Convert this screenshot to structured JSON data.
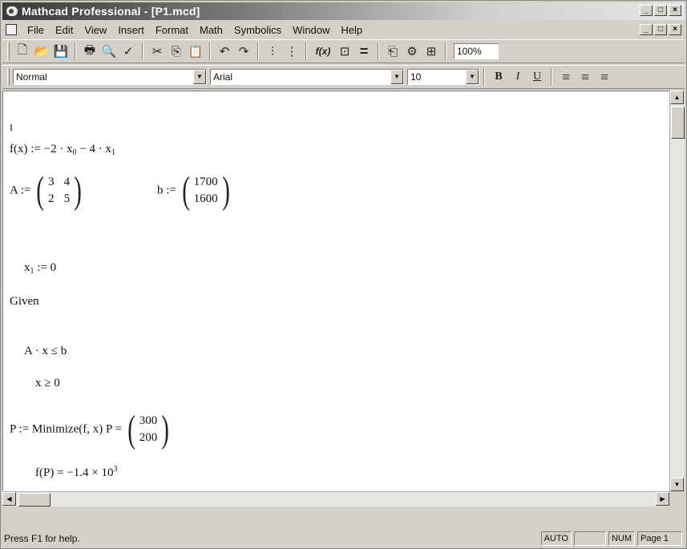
{
  "window": {
    "title": "Mathcad Professional - [P1.mcd]",
    "buttons": {
      "minimize": "_",
      "maximize": "□",
      "close": "×"
    }
  },
  "menubar": {
    "items": [
      {
        "label": "File"
      },
      {
        "label": "Edit"
      },
      {
        "label": "View"
      },
      {
        "label": "Insert"
      },
      {
        "label": "Format"
      },
      {
        "label": "Math"
      },
      {
        "label": "Symbolics"
      },
      {
        "label": "Window"
      },
      {
        "label": "Help"
      }
    ]
  },
  "toolbar": {
    "zoom": "100%",
    "icons": {
      "new": "🗋",
      "open": "📂",
      "save": "💾",
      "print": "🖶",
      "preview": "🔍",
      "spell": "✓",
      "cut": "✂",
      "copy": "⎘",
      "paste": "📋",
      "undo": "↶",
      "redo": "↷",
      "insert_graph": "⫶",
      "insert_matrix": "⋮",
      "insert_function": "f(x)",
      "insert_units": "⊡",
      "calculate": "=",
      "resource": "⎗",
      "components": "⚙",
      "align": "⊞"
    }
  },
  "formatbar": {
    "style": "Normal",
    "font": "Arial",
    "size": "10",
    "bold": "B",
    "italic": "I",
    "underline": "U",
    "align_left": "≡",
    "align_center": "≡",
    "align_right": "≡"
  },
  "document": {
    "line1": "I",
    "f_def": {
      "lhs": "f(x) := −2 · x",
      "sub0": "0",
      "mid": " − 4 · x",
      "sub1": "1"
    },
    "A_def": {
      "lhs": "A :=",
      "m11": "3",
      "m12": "4",
      "m21": "2",
      "m22": "5"
    },
    "b_def": {
      "lhs": "b :=",
      "v1": "1700",
      "v2": "1600"
    },
    "x1_def": {
      "lhs": "x",
      "sub": "1",
      "rhs": " := 0"
    },
    "given": "Given",
    "constraint1": "A · x ≤ b",
    "constraint2": "x ≥ 0",
    "minimize": {
      "text": "P := Minimize(f, x)    P = ",
      "p1": "300",
      "p2": "200"
    },
    "result": {
      "text": "f(P) = −1.4 × 10",
      "exp": "3"
    }
  },
  "statusbar": {
    "help": "Press F1 for help.",
    "mode": "AUTO",
    "blank": "",
    "num": "NUM",
    "page": "Page 1"
  }
}
